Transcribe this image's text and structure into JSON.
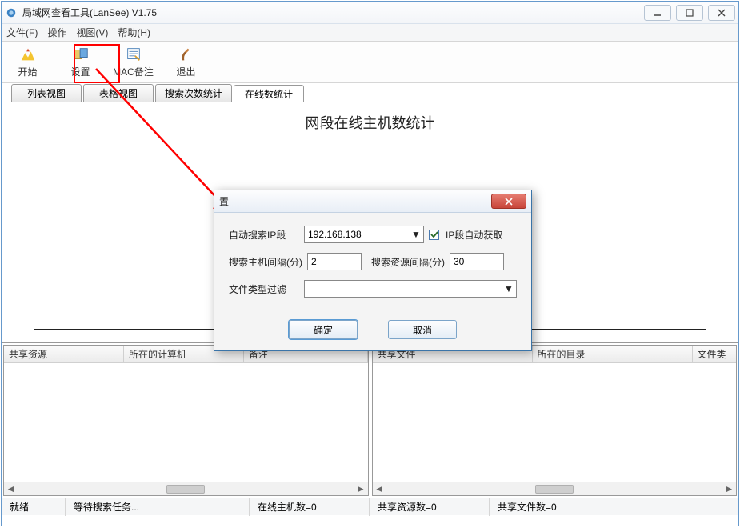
{
  "window": {
    "title": "局域网查看工具(LanSee) V1.75"
  },
  "menu": {
    "file": "文件(F)",
    "operate": "操作",
    "view": "视图(V)",
    "help": "帮助(H)"
  },
  "toolbar": {
    "start": "开始",
    "settings": "设置",
    "macRemark": "MAC备注",
    "exit": "退出"
  },
  "tabs": {
    "listView": "列表视图",
    "gridView": "表格视图",
    "searchCount": "搜索次数统计",
    "onlineCount": "在线数统计"
  },
  "chart": {
    "title": "网段在线主机数统计"
  },
  "panelLeft": {
    "col1": "共享资源",
    "col2": "所在的计算机",
    "col3": "备注"
  },
  "panelRight": {
    "col1": "共享文件",
    "col2": "所在的目录",
    "col3": "文件类"
  },
  "status": {
    "ready": "就绪",
    "waiting": "等待搜索任务...",
    "online": "在线主机数=0",
    "shareRes": "共享资源数=0",
    "shareFile": "共享文件数=0"
  },
  "dialog": {
    "title": "置",
    "autoSearchIp": "自动搜索IP段",
    "ipValue": "192.168.138",
    "ipAutoGet": "IP段自动获取",
    "hostInterval": "搜索主机间隔(分)",
    "hostIntervalValue": "2",
    "resInterval": "搜索资源间隔(分)",
    "resIntervalValue": "30",
    "fileFilter": "文件类型过滤",
    "ok": "确定",
    "cancel": "取消"
  }
}
